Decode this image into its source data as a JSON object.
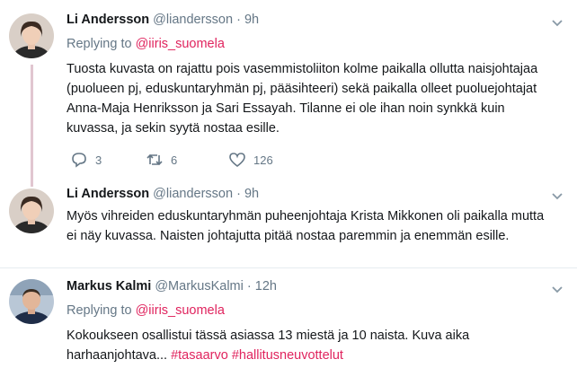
{
  "tweets": [
    {
      "name": "Li Andersson",
      "handle": "@liandersson",
      "dot": "·",
      "time": "9h",
      "reply_prefix": "Replying to",
      "reply_to": "@iiris_suomela",
      "text": "Tuosta kuvasta on rajattu pois vasemmistoliiton kolme paikalla ollutta naisjohtajaa (puolueen pj, eduskuntaryhmän pj, pääsihteeri) sekä paikalla olleet puoluejohtajat Anna-Maja Henriksson ja Sari Essayah. Tilanne ei ole ihan noin synkkä kuin kuvassa, ja sekin syytä nostaa esille.",
      "replies": "3",
      "retweets": "6",
      "likes": "126"
    },
    {
      "name": "Li Andersson",
      "handle": "@liandersson",
      "dot": "·",
      "time": "9h",
      "text": "Myös vihreiden eduskuntaryhmän puheenjohtaja Krista Mikkonen oli paikalla mutta ei näy kuvassa. Naisten johtajutta pitää nostaa paremmin ja enemmän esille."
    },
    {
      "name": "Markus Kalmi",
      "handle": "@MarkusKalmi",
      "dot": "·",
      "time": "12h",
      "reply_prefix": "Replying to",
      "reply_to": "@iiris_suomela",
      "text": "Kokoukseen osallistui tässä asiassa 13 miestä ja 10 naista. Kuva aika harhaanjohtava...",
      "hashtag1": "#tasaarvo",
      "hashtag2": "#hallitusneuvottelut"
    }
  ],
  "colors": {
    "accent": "#e0245e",
    "muted": "#657786",
    "thread": "#e1c6d0"
  }
}
